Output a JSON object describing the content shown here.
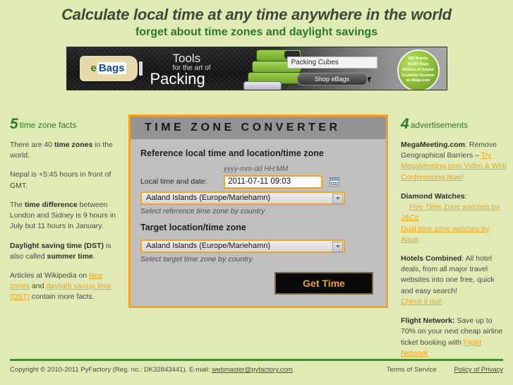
{
  "header": {
    "headline": "Calculate local time at any time anywhere in the world",
    "subheadline": "forget about time zones and daylight savings"
  },
  "banner_ad": {
    "brand_e": "e",
    "brand_bags": "Bags",
    "line1": "Tools",
    "line2": "for the art of",
    "line3": "Packing",
    "search_value": "Packing Cubes",
    "shop_button": "Shop eBags",
    "promo_line1": "550 Brands",
    "promo_line2": "38,000 Bags",
    "promo_line3": "Millions of Helpful",
    "promo_line4": "Customer Reviews",
    "promo_line5": "at eBags.com"
  },
  "left_column": {
    "head_number": "5",
    "head_text": "time zone facts",
    "facts": [
      {
        "pre": "There are 40 ",
        "bold": "time zones",
        "post": " in the world."
      },
      {
        "pre": "Nepal is +5:45 hours in front of GMT.",
        "bold": "",
        "post": ""
      },
      {
        "pre": "The ",
        "bold": "time difference",
        "post": " between London and Sidney is 9 hours in July but 11 hours in January."
      },
      {
        "pre": "",
        "bold": "Daylight saving time (DST)",
        "post": " is also called summer time."
      }
    ],
    "fact4_bold_tail": "summer time",
    "fact4_mid": " is also called ",
    "fact4_end": ".",
    "wiki_pre": "Articles at Wikipedia on ",
    "wiki_link1": "time zones",
    "wiki_mid": " and ",
    "wiki_link2": "daylight saving time (DST)",
    "wiki_post": " contain more facts."
  },
  "converter": {
    "title": "TIME ZONE CONVERTER",
    "reference_section": "Reference local time and location/time zone",
    "format_hint": "yyyy-mm-dd HH:MM",
    "time_label": "Local time and date:",
    "time_value": "2011-07-11 09:03",
    "time_placeholder": "yyyy-mm-dd HH:MM",
    "reference_zone": "Aaland Islands (Europe/Mariehamn)",
    "reference_hint": "Select reference time zone by country",
    "target_section": "Target location/time zone",
    "target_zone": "Aaland Islands (Europe/Mariehamn)",
    "target_hint": "Select target time zone by country",
    "submit_label": "Get Time"
  },
  "right_column": {
    "head_number": "4",
    "head_text": "advertisements",
    "ads": [
      {
        "title": "MegaMeeting.com",
        "sep": ": ",
        "text": "Remove Geographical Barriers – ",
        "link": "Try MegaMeeting.com Video & Web Conferencing Now!"
      },
      {
        "title": "Diamond Watches",
        "sep": ":",
        "text": "",
        "link1": "Five Time Zone watches by J&Co",
        "link2": "Dual time zone watches by Aqua"
      },
      {
        "title": "Hotels Combined",
        "sep": ": ",
        "text": "All hotel deals, from all major travel websites into one free, quick and easy search!",
        "link": "Check it out!"
      },
      {
        "title": "Flight Network:",
        "sep": " ",
        "text": "Save up to 70% on your next cheap airline ticket booking with ",
        "link": "Flight Network"
      }
    ]
  },
  "footer": {
    "copyright": "Copyright © 2010-2011 PyFactory (Reg. no.: DK32843441). E-mail: ",
    "email": "webmaster@pyfactory.com",
    "copyright_end": ".",
    "terms": "Terms of Service",
    "privacy": "Policy of Privacy"
  },
  "colors": {
    "page_background": "#dfeab4",
    "accent_orange": "#f5a21e",
    "heading_green": "#2e7d24",
    "panel_header_gray": "#949494",
    "panel_body_gray": "#bfbfbf",
    "footer_rule_green": "#4b8a36"
  }
}
